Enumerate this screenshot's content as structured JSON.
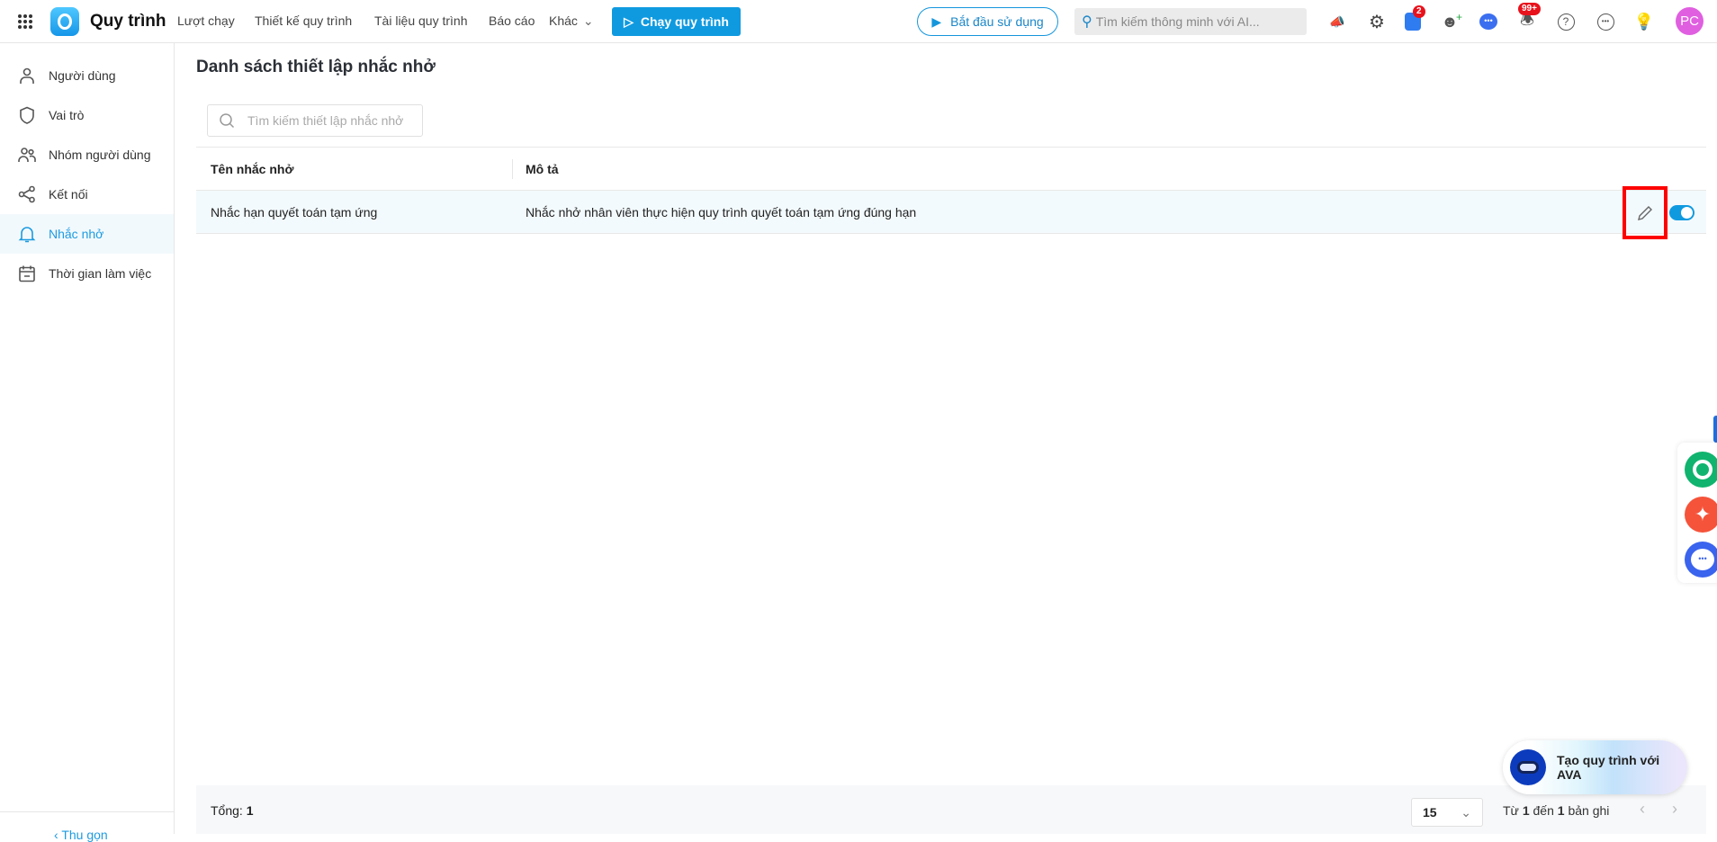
{
  "header": {
    "app_name": "Quy trình",
    "nav": [
      "Lượt chạy",
      "Thiết kế quy trình",
      "Tài liệu quy trình",
      "Báo cáo",
      "Khác"
    ],
    "run_button": "Chạy quy trình",
    "start_button": "Bắt đầu sử dụng",
    "search_placeholder": "Tìm kiếm thông minh với AI...",
    "cart_badge": "2",
    "notification_badge": "99+",
    "avatar": "PC"
  },
  "sidebar": {
    "items": [
      {
        "label": "Người dùng",
        "icon": "user-icon"
      },
      {
        "label": "Vai trò",
        "icon": "shield-icon"
      },
      {
        "label": "Nhóm người dùng",
        "icon": "users-icon"
      },
      {
        "label": "Kết nối",
        "icon": "share-icon"
      },
      {
        "label": "Nhắc nhở",
        "icon": "bell-icon",
        "active": true
      },
      {
        "label": "Thời gian làm việc",
        "icon": "calendar-icon"
      }
    ],
    "collapse": "Thu gọn"
  },
  "main": {
    "title": "Danh sách thiết lập nhắc nhở",
    "search_placeholder": "Tìm kiếm thiết lập nhắc nhở",
    "columns": [
      "Tên nhắc nhở",
      "Mô tả"
    ],
    "rows": [
      {
        "name": "Nhắc hạn quyết toán tạm ứng",
        "description": "Nhắc nhở nhân viên thực hiện quy trình quyết toán tạm ứng đúng hạn",
        "enabled": true
      }
    ]
  },
  "footer": {
    "total_label": "Tổng:",
    "total": "1",
    "page_size": "15",
    "range_from_label": "Từ",
    "range_from": "1",
    "range_to_label": "đến",
    "range_to": "1",
    "range_suffix": "bản ghi"
  },
  "ava_button": "Tạo quy trình với AVA",
  "colors": {
    "accent": "#0f9ae0",
    "highlight": "#ff0000"
  }
}
